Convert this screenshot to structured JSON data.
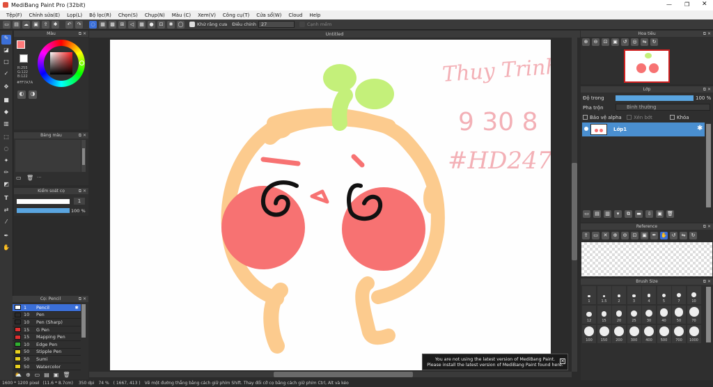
{
  "app": {
    "title": "MediBang Paint Pro (32bit)",
    "doc_tab": "Untitled"
  },
  "menu": [
    "Tệp(F)",
    "Chỉnh sửa(E)",
    "Lọp(L)",
    "Bộ lọc(R)",
    "Chọn(S)",
    "Chụp(N)",
    "Màu (C)",
    "Xem(V)",
    "Công cụ(T)",
    "Cửa sổ(W)",
    "Cloud",
    "Help"
  ],
  "toolbar": {
    "antialias_label": "Khử răng cưa",
    "correction_label": "Điều chỉnh",
    "correction_value": "27",
    "edge_label": "Cạnh mềm"
  },
  "color_panel": {
    "title": "Màu",
    "rgb": "R:255\nG:122\nB:122",
    "hex": "#FF7A7A",
    "current": "#ff7a7a"
  },
  "palette_panel": {
    "title": "Bảng màu"
  },
  "brush_control": {
    "title": "Kiểm soát cọ",
    "size": "1",
    "opacity": "100 %"
  },
  "brush_panel": {
    "title": "Cọ: Pencil",
    "items": [
      {
        "size": "1",
        "name": "Pencil",
        "color": "#3b6fd8",
        "selected": true
      },
      {
        "size": "10",
        "name": "Pen",
        "color": "#2a2a2a"
      },
      {
        "size": "10",
        "name": "Pen (Sharp)",
        "color": "#2a2a2a"
      },
      {
        "size": "15",
        "name": "G Pen",
        "color": "#e03030"
      },
      {
        "size": "15",
        "name": "Mapping Pen",
        "color": "#e03030"
      },
      {
        "size": "10",
        "name": "Edge Pen",
        "color": "#30b030"
      },
      {
        "size": "50",
        "name": "Stipple Pen",
        "color": "#e8d020"
      },
      {
        "size": "50",
        "name": "Sumi",
        "color": "#e8d020"
      },
      {
        "size": "50",
        "name": "Watercolor",
        "color": "#e8d020"
      }
    ]
  },
  "navigator": {
    "title": "Hoa tiêu"
  },
  "layer_panel": {
    "title": "Lớp",
    "opacity_label": "Độ trong",
    "opacity_value": "100 %",
    "blend_label": "Pha trộn",
    "blend_value": "Bình thường",
    "protect_alpha": "Bảo vệ alpha",
    "clipping": "Xén bớt",
    "lock": "Khóa",
    "layer_name": "Lớp1",
    "opacity": 1.0
  },
  "reference": {
    "title": "Reference"
  },
  "brush_size": {
    "title": "Brush Size",
    "sizes": [
      "1",
      "1.5",
      "2",
      "3",
      "4",
      "5",
      "7",
      "10",
      "12",
      "15",
      "20",
      "25",
      "30",
      "40",
      "50",
      "70",
      "100",
      "150",
      "200",
      "300",
      "400",
      "500",
      "700",
      "1000"
    ]
  },
  "sketch_text": {
    "line1": "Thuy Trinh",
    "line2": "9 30 8",
    "line3": "#HD247"
  },
  "notice": {
    "line1": "You are not using the latest version of MediBang Paint.",
    "line2": "Please install the latest version of MediBang Paint found here."
  },
  "status": {
    "size": "1600 * 1200 pixel",
    "cm": "(11.6 * 8.7cm)",
    "dpi": "350 dpi",
    "zoom": "74 %",
    "coords": "( 1667, 413 )",
    "hint": "Vẽ một đường thẳng bằng cách giữ phím Shift. Thay đổi cỡ cọ bằng cách giữ phím Ctrl, Alt và kéo"
  },
  "colors": {
    "cheek": "#f77272",
    "body": "#fccb8e",
    "sprout": "#c4f07a",
    "stroke": "#111111",
    "sketch": "#f0a0a8"
  }
}
